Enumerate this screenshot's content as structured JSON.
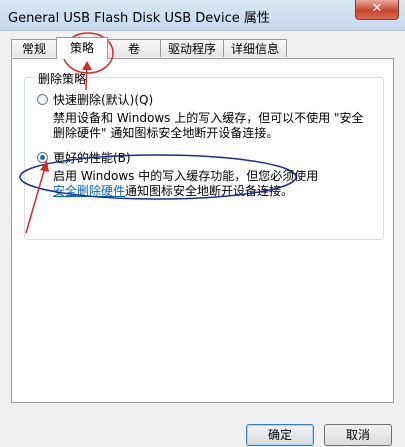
{
  "window": {
    "title": "General USB Flash Disk USB Device 属性",
    "close_glyph": "✕"
  },
  "tabs": [
    {
      "label": "常规"
    },
    {
      "label": "策略"
    },
    {
      "label": "卷"
    },
    {
      "label": "驱动程序"
    },
    {
      "label": "详细信息"
    }
  ],
  "active_tab": "策略",
  "removal_policy": {
    "group_label": "删除策略",
    "quick_removal": {
      "label": "快速删除(默认)(Q)",
      "selected": false,
      "desc_line1": "禁用设备和 Windows 上的写入缓存，但可以不使用 \"安全",
      "desc_line2": "删除硬件\" 通知图标安全地断开设备连接。"
    },
    "better_performance": {
      "label": "更好的性能(B)",
      "selected": true,
      "desc_line1": "启用 Windows 中的写入缓存功能，但您必须使用",
      "desc_link": "安全删除硬件",
      "desc_line2_rest": "通知图标安全地断开设备连接。"
    }
  },
  "buttons": {
    "ok": "确定",
    "cancel": "取消"
  },
  "annotation_color": "#d42a2a",
  "ellipse_color": "#1a2c8c"
}
